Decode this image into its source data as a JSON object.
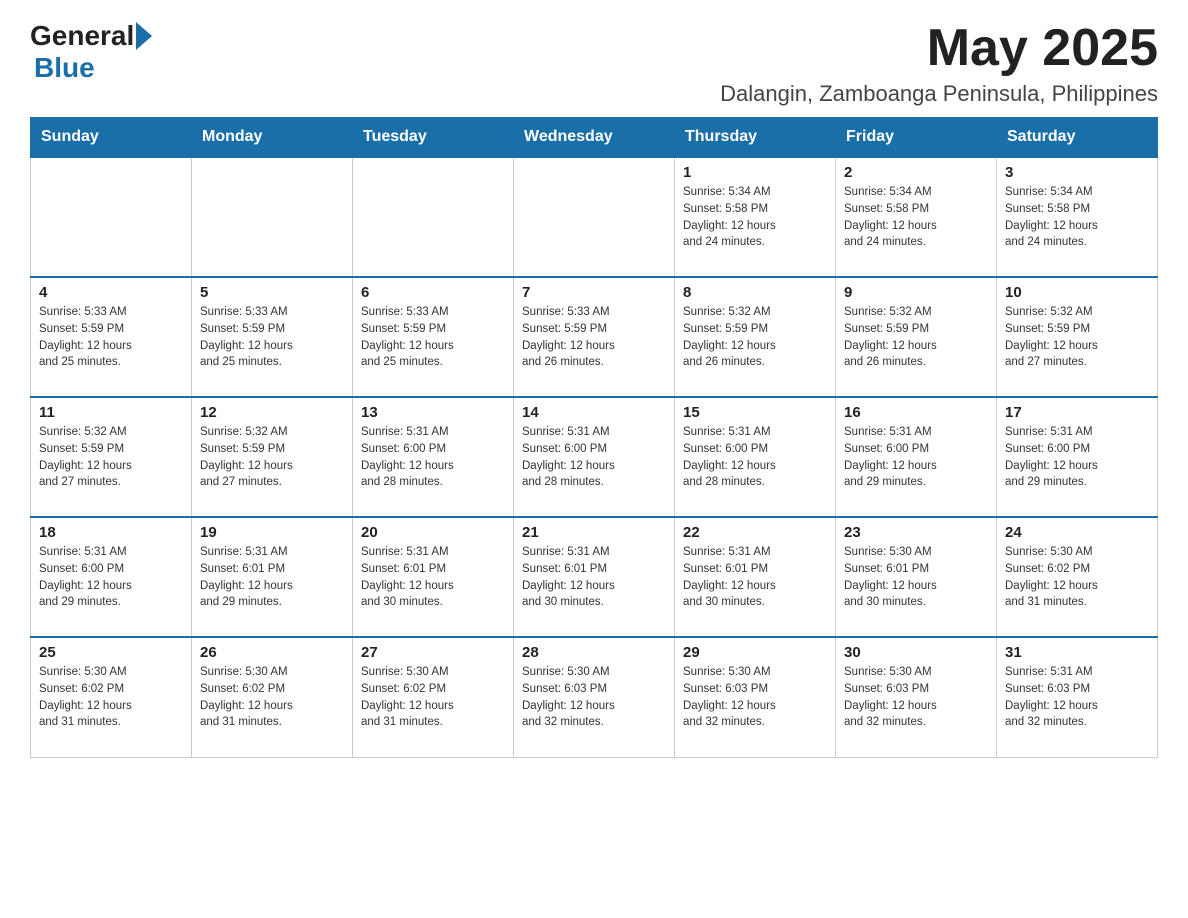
{
  "header": {
    "logo_general": "General",
    "logo_blue": "Blue",
    "month_year": "May 2025",
    "location": "Dalangin, Zamboanga Peninsula, Philippines"
  },
  "days_of_week": [
    "Sunday",
    "Monday",
    "Tuesday",
    "Wednesday",
    "Thursday",
    "Friday",
    "Saturday"
  ],
  "weeks": [
    [
      {
        "day": "",
        "info": ""
      },
      {
        "day": "",
        "info": ""
      },
      {
        "day": "",
        "info": ""
      },
      {
        "day": "",
        "info": ""
      },
      {
        "day": "1",
        "info": "Sunrise: 5:34 AM\nSunset: 5:58 PM\nDaylight: 12 hours\nand 24 minutes."
      },
      {
        "day": "2",
        "info": "Sunrise: 5:34 AM\nSunset: 5:58 PM\nDaylight: 12 hours\nand 24 minutes."
      },
      {
        "day": "3",
        "info": "Sunrise: 5:34 AM\nSunset: 5:58 PM\nDaylight: 12 hours\nand 24 minutes."
      }
    ],
    [
      {
        "day": "4",
        "info": "Sunrise: 5:33 AM\nSunset: 5:59 PM\nDaylight: 12 hours\nand 25 minutes."
      },
      {
        "day": "5",
        "info": "Sunrise: 5:33 AM\nSunset: 5:59 PM\nDaylight: 12 hours\nand 25 minutes."
      },
      {
        "day": "6",
        "info": "Sunrise: 5:33 AM\nSunset: 5:59 PM\nDaylight: 12 hours\nand 25 minutes."
      },
      {
        "day": "7",
        "info": "Sunrise: 5:33 AM\nSunset: 5:59 PM\nDaylight: 12 hours\nand 26 minutes."
      },
      {
        "day": "8",
        "info": "Sunrise: 5:32 AM\nSunset: 5:59 PM\nDaylight: 12 hours\nand 26 minutes."
      },
      {
        "day": "9",
        "info": "Sunrise: 5:32 AM\nSunset: 5:59 PM\nDaylight: 12 hours\nand 26 minutes."
      },
      {
        "day": "10",
        "info": "Sunrise: 5:32 AM\nSunset: 5:59 PM\nDaylight: 12 hours\nand 27 minutes."
      }
    ],
    [
      {
        "day": "11",
        "info": "Sunrise: 5:32 AM\nSunset: 5:59 PM\nDaylight: 12 hours\nand 27 minutes."
      },
      {
        "day": "12",
        "info": "Sunrise: 5:32 AM\nSunset: 5:59 PM\nDaylight: 12 hours\nand 27 minutes."
      },
      {
        "day": "13",
        "info": "Sunrise: 5:31 AM\nSunset: 6:00 PM\nDaylight: 12 hours\nand 28 minutes."
      },
      {
        "day": "14",
        "info": "Sunrise: 5:31 AM\nSunset: 6:00 PM\nDaylight: 12 hours\nand 28 minutes."
      },
      {
        "day": "15",
        "info": "Sunrise: 5:31 AM\nSunset: 6:00 PM\nDaylight: 12 hours\nand 28 minutes."
      },
      {
        "day": "16",
        "info": "Sunrise: 5:31 AM\nSunset: 6:00 PM\nDaylight: 12 hours\nand 29 minutes."
      },
      {
        "day": "17",
        "info": "Sunrise: 5:31 AM\nSunset: 6:00 PM\nDaylight: 12 hours\nand 29 minutes."
      }
    ],
    [
      {
        "day": "18",
        "info": "Sunrise: 5:31 AM\nSunset: 6:00 PM\nDaylight: 12 hours\nand 29 minutes."
      },
      {
        "day": "19",
        "info": "Sunrise: 5:31 AM\nSunset: 6:01 PM\nDaylight: 12 hours\nand 29 minutes."
      },
      {
        "day": "20",
        "info": "Sunrise: 5:31 AM\nSunset: 6:01 PM\nDaylight: 12 hours\nand 30 minutes."
      },
      {
        "day": "21",
        "info": "Sunrise: 5:31 AM\nSunset: 6:01 PM\nDaylight: 12 hours\nand 30 minutes."
      },
      {
        "day": "22",
        "info": "Sunrise: 5:31 AM\nSunset: 6:01 PM\nDaylight: 12 hours\nand 30 minutes."
      },
      {
        "day": "23",
        "info": "Sunrise: 5:30 AM\nSunset: 6:01 PM\nDaylight: 12 hours\nand 30 minutes."
      },
      {
        "day": "24",
        "info": "Sunrise: 5:30 AM\nSunset: 6:02 PM\nDaylight: 12 hours\nand 31 minutes."
      }
    ],
    [
      {
        "day": "25",
        "info": "Sunrise: 5:30 AM\nSunset: 6:02 PM\nDaylight: 12 hours\nand 31 minutes."
      },
      {
        "day": "26",
        "info": "Sunrise: 5:30 AM\nSunset: 6:02 PM\nDaylight: 12 hours\nand 31 minutes."
      },
      {
        "day": "27",
        "info": "Sunrise: 5:30 AM\nSunset: 6:02 PM\nDaylight: 12 hours\nand 31 minutes."
      },
      {
        "day": "28",
        "info": "Sunrise: 5:30 AM\nSunset: 6:03 PM\nDaylight: 12 hours\nand 32 minutes."
      },
      {
        "day": "29",
        "info": "Sunrise: 5:30 AM\nSunset: 6:03 PM\nDaylight: 12 hours\nand 32 minutes."
      },
      {
        "day": "30",
        "info": "Sunrise: 5:30 AM\nSunset: 6:03 PM\nDaylight: 12 hours\nand 32 minutes."
      },
      {
        "day": "31",
        "info": "Sunrise: 5:31 AM\nSunset: 6:03 PM\nDaylight: 12 hours\nand 32 minutes."
      }
    ]
  ]
}
